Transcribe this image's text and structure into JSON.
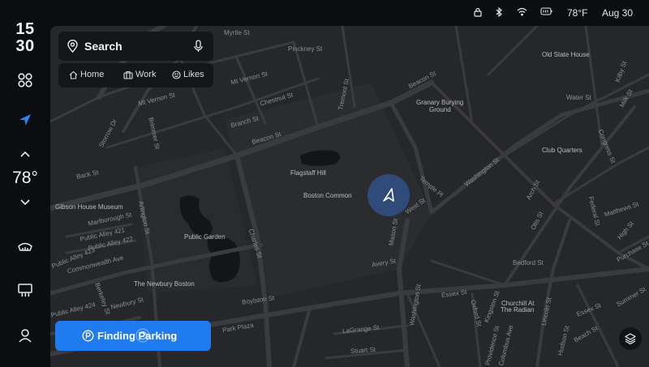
{
  "clock": {
    "hours": "15",
    "minutes": "30"
  },
  "climate": {
    "temperature": "78°"
  },
  "status_bar": {
    "outside_temp": "78°F",
    "date": "Aug 30"
  },
  "search": {
    "label": "Search"
  },
  "quick_destinations": [
    {
      "label": "Home",
      "icon": "home-icon"
    },
    {
      "label": "Work",
      "icon": "briefcase-icon"
    },
    {
      "label": "Likes",
      "icon": "smile-icon"
    }
  ],
  "parking": {
    "label": "Finding Parking"
  },
  "map": {
    "places": {
      "flagstaff_hill": "Flagstaff Hill",
      "boston_common": "Boston Common",
      "public_garden": "Public Garden",
      "granary_1": "Granary Burying",
      "granary_2": "Ground",
      "old_state_house": "Old State House",
      "club_quarters": "Club Quarters",
      "gibson_house": "Gibson House Museum",
      "newbury_boston": "The Newbury Boston",
      "churchill": "Churchill At",
      "the_radian": "The Radian"
    },
    "streets": {
      "myrtle": "Myrtle St",
      "pinckney": "Pinckney St",
      "mt_vernon_1": "Mt Vernon St",
      "mt_vernon_2": "Mt Vernon St",
      "chestnut": "Chestnut St",
      "branch": "Branch St",
      "beacon_1": "Beacon St",
      "beacon_2": "Beacon St",
      "storrow": "Storrow Dr",
      "brimmer": "Brimmer St",
      "back": "Back St",
      "marlborough": "Marlborough St",
      "arlington": "Arlington St",
      "public_alley_421": "Public Alley 421",
      "public_alley_422": "Public Alley 422",
      "public_alley_423": "Public Alley 423",
      "comm_ave": "Commonwealth Ave",
      "newbury": "Newbury St",
      "public_alley_424": "Public Alley 424",
      "berkeley": "Berkeley St",
      "charles": "Charles St",
      "boylston": "Boylston St",
      "park_plaza": "Park Plaza",
      "stuart": "Stuart St",
      "lagrange": "LaGrange St",
      "avery": "Avery St",
      "mason": "Mason St",
      "washington_1": "Washington St",
      "washington_2": "Washington St",
      "west": "West St",
      "temple": "Temple Pl",
      "water": "Water St",
      "milk": "Milk St",
      "kilby": "Kilby St",
      "congress": "Congress St",
      "arch": "Arch St",
      "otis": "Otis St",
      "federal": "Federal St",
      "high": "High St",
      "matthews": "Matthews St",
      "purchase": "Purchase St",
      "bedford": "Bedford St",
      "essex_1": "Essex St",
      "essex_2": "Essex St",
      "oxford": "Oxford St",
      "lincoln": "Lincoln St",
      "summer": "Summer St",
      "kingston": "Kingston St",
      "hudson": "Hudson St",
      "beach": "Beach St",
      "tremont": "Tremont St",
      "providence": "Providence St",
      "columbus": "Columbus Ave"
    }
  },
  "colors": {
    "accent": "#1e7cf0",
    "map_bg": "#26272a",
    "road": "#3a3b3f",
    "water": "#161719"
  }
}
